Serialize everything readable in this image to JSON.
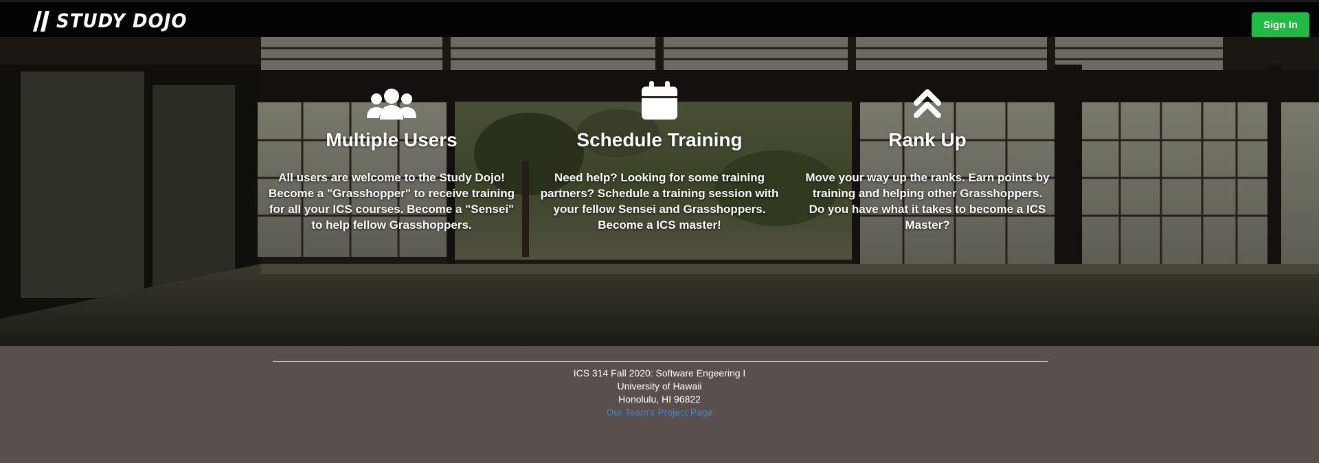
{
  "navbar": {
    "logo_text": "STUDY DOJO",
    "signin_label": "Sign In",
    "signin_color": "#21ba45"
  },
  "features": [
    {
      "icon": "users-icon",
      "title": "Multiple Users",
      "text": "All users are welcome to the Study Dojo! Become a \"Grasshopper\" to receive training for all your ICS courses. Become a \"Sensei\" to help fellow Grasshoppers."
    },
    {
      "icon": "calendar-icon",
      "title": "Schedule Training",
      "text": "Need help? Looking for some training partners? Schedule a training session with your fellow Sensei and Grasshoppers. Become a ICS master!"
    },
    {
      "icon": "double-chevron-up-icon",
      "title": "Rank Up",
      "text": "Move your way up the ranks. Earn points by training and helping other Grasshoppers. Do you have what it takes to become a ICS Master?"
    }
  ],
  "footer": {
    "line1": "ICS 314 Fall 2020: Software Engeering I",
    "line2": "University of Hawaii",
    "line3": "Honolulu, HI 96822",
    "link_label": "Our Team's Project Page",
    "background": "#59504d",
    "link_color": "#4183c4"
  }
}
